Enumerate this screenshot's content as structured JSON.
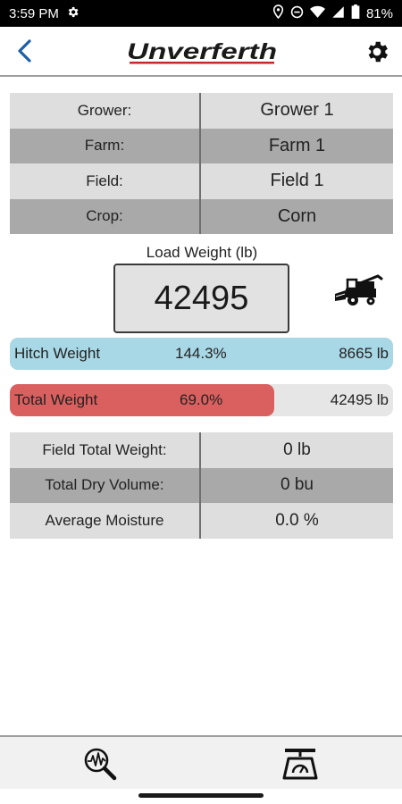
{
  "status_bar": {
    "time": "3:59 PM",
    "battery": "81%",
    "icons": [
      "settings-icon",
      "location-icon",
      "do-not-disturb-icon",
      "wifi-icon",
      "signal-icon",
      "battery-icon"
    ]
  },
  "header": {
    "back_icon": "chevron-left-icon",
    "logo_text": "Unverferth",
    "settings_icon": "gear-icon"
  },
  "info_table": [
    {
      "label": "Grower:",
      "value": "Grower 1"
    },
    {
      "label": "Farm:",
      "value": "Farm 1"
    },
    {
      "label": "Field:",
      "value": "Field 1"
    },
    {
      "label": "Crop:",
      "value": "Corn"
    }
  ],
  "load": {
    "label": "Load Weight (lb)",
    "value": "42495",
    "icon": "combine-harvester-icon"
  },
  "hitch_bar": {
    "label": "Hitch Weight",
    "percent_text": "144.3%",
    "weight_text": "8665 lb",
    "fill_fraction": 1.0,
    "color": "#a8d8e6"
  },
  "total_bar": {
    "label": "Total Weight",
    "percent_text": "69.0%",
    "weight_text": "42495 lb",
    "fill_fraction": 0.69,
    "color": "#d9605f"
  },
  "totals_table": [
    {
      "label": "Field Total Weight:",
      "value": "0 lb"
    },
    {
      "label": "Total Dry Volume:",
      "value": "0 bu"
    },
    {
      "label": "Average Moisture",
      "value": "0.0 %"
    }
  ],
  "bottom_nav": {
    "left_icon": "moisture-search-icon",
    "right_icon": "scale-icon"
  },
  "colors": {
    "accent_blue": "#1f5fa6",
    "logo_red": "#c62828",
    "row_light": "#dedede",
    "row_dark": "#a9a9a9"
  }
}
